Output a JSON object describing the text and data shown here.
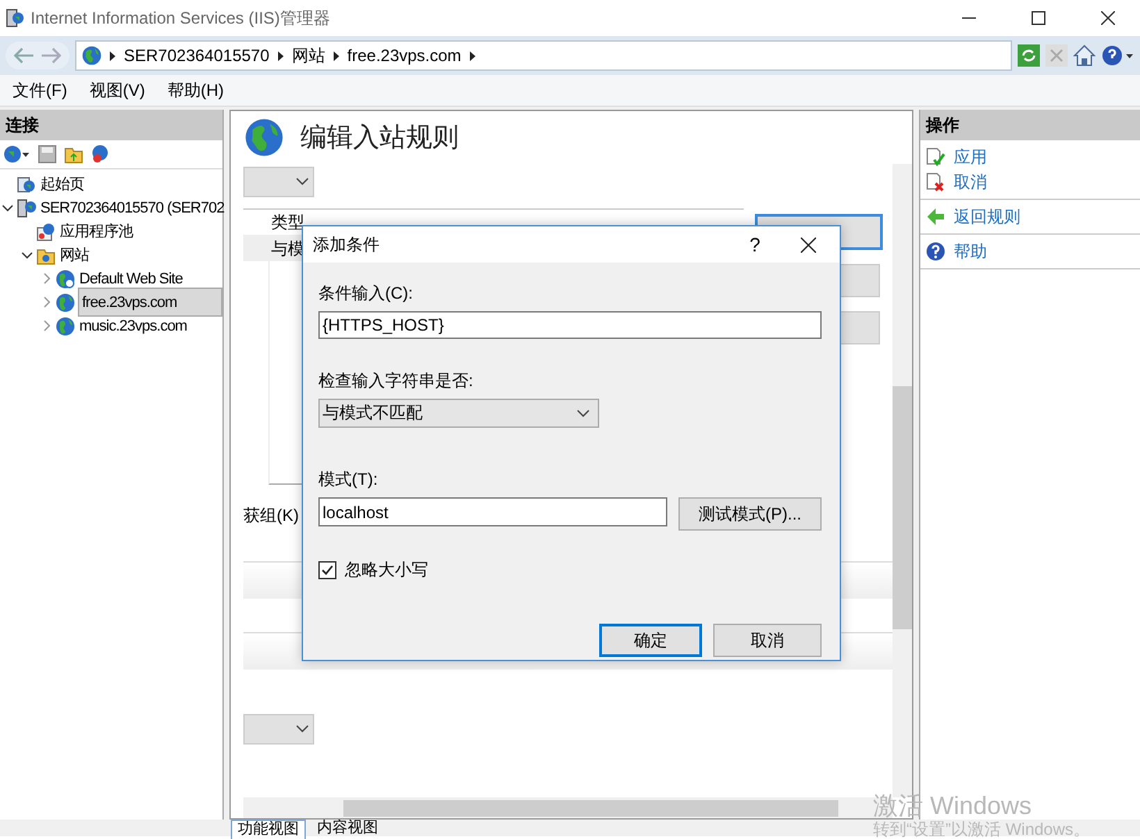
{
  "window": {
    "title": "Internet Information Services (IIS)管理器"
  },
  "address_bar": {
    "crumbs": [
      "SER702364015570",
      "网站",
      "free.23vps.com"
    ]
  },
  "menu": [
    "文件(F)",
    "视图(V)",
    "帮助(H)"
  ],
  "connections": {
    "title": "连接",
    "tree": [
      {
        "label": "起始页",
        "kind": "start",
        "selected": false
      },
      {
        "label": "SER702364015570 (SER702",
        "kind": "server",
        "selected": false,
        "expanded": true,
        "children": [
          {
            "label": "应用程序池",
            "kind": "pools",
            "selected": false
          },
          {
            "label": "网站",
            "kind": "folder",
            "selected": false,
            "expanded": true,
            "children": [
              {
                "label": "Default Web Site",
                "kind": "default-site",
                "selected": false,
                "expanded": false
              },
              {
                "label": "free.23vps.com",
                "kind": "site",
                "selected": true,
                "expanded": false
              },
              {
                "label": "music.23vps.com",
                "kind": "site",
                "selected": false,
                "expanded": false
              }
            ]
          }
        ]
      }
    ]
  },
  "page": {
    "title": "编辑入站规则",
    "table": {
      "columns": [
        "类型"
      ],
      "rows": [
        [
          "与模"
        ]
      ]
    },
    "partial_label": "获组(K)"
  },
  "dialog": {
    "title": "添加条件",
    "help": "?",
    "condition_input": {
      "label": "条件输入(C):",
      "value": "{HTTPS_HOST}"
    },
    "check_input": {
      "label": "检查输入字符串是否:",
      "value": "与模式不匹配"
    },
    "pattern": {
      "label": "模式(T):",
      "value": "localhost"
    },
    "test_button": "测试模式(P)...",
    "ignore_case": {
      "label": "忽略大小写",
      "checked": true
    },
    "buttons": [
      {
        "label": "确定",
        "default": true
      },
      {
        "label": "取消",
        "default": false
      }
    ]
  },
  "actions": {
    "title": "操作",
    "groups": [
      [
        {
          "label": "应用",
          "kind": "apply"
        },
        {
          "label": "取消",
          "kind": "cancel"
        }
      ],
      [
        {
          "label": "返回规则",
          "kind": "back"
        }
      ],
      [
        {
          "label": "帮助",
          "kind": "help"
        }
      ]
    ]
  },
  "view_tabs": [
    {
      "label": "功能视图",
      "selected": true
    },
    {
      "label": "内容视图",
      "selected": false
    }
  ],
  "activation_notice": {
    "title": "激活 Windows",
    "hint": "转到“设置”以激活 Windows。"
  }
}
